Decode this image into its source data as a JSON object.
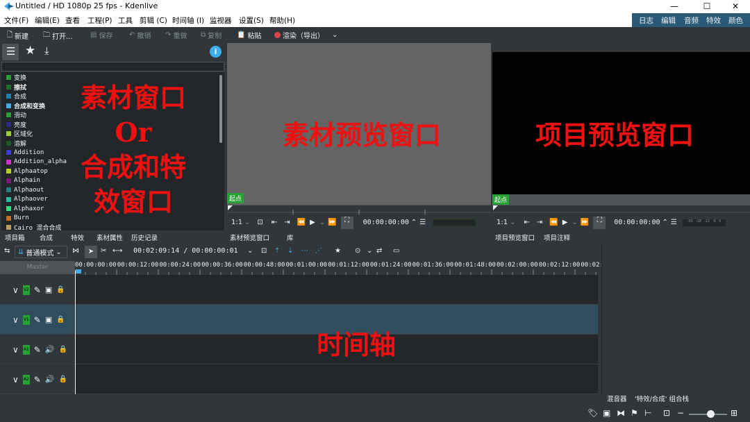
{
  "window": {
    "title": "Untitled / HD 1080p 25 fps - Kdenlive",
    "min": "—",
    "max": "☐",
    "close": "✕"
  },
  "menu": [
    "文件(F)",
    "编辑(E)",
    "查看",
    "工程(P)",
    "工具",
    "剪辑 (C)",
    "时间轴 (I)",
    "监视器",
    "设置(S)",
    "帮助(H)"
  ],
  "layouts": [
    "日志",
    "编辑",
    "音频",
    "特效",
    "颜色"
  ],
  "toolbar": {
    "new": "新建",
    "open": "打开...",
    "save": "保存",
    "undo": "撤销",
    "redo": "重做",
    "copy": "复制",
    "paste": "粘贴",
    "render": "渲染（导出）"
  },
  "effects": [
    {
      "label": "变换",
      "color": "#27a036",
      "bold": false
    },
    {
      "label": "擦拭",
      "color": "#1f6f2a",
      "bold": true
    },
    {
      "label": "合成",
      "color": "#1d7fb8",
      "bold": false
    },
    {
      "label": "合成和变换",
      "color": "#3daee9",
      "bold": true
    },
    {
      "label": "滑动",
      "color": "#27a036",
      "bold": false
    },
    {
      "label": "亮度",
      "color": "#2a2a8a",
      "bold": false
    },
    {
      "label": "区域化",
      "color": "#9acd32",
      "bold": false
    },
    {
      "label": "溶解",
      "color": "#1a5a2a",
      "bold": false
    },
    {
      "label": "Addition",
      "color": "#3a3ae0",
      "bold": false
    },
    {
      "label": "Addition_alpha",
      "color": "#d030d0",
      "bold": false
    },
    {
      "label": "Alphaatop",
      "color": "#b8d020",
      "bold": false
    },
    {
      "label": "Alphain",
      "color": "#7a1a7a",
      "bold": false
    },
    {
      "label": "Alphaout",
      "color": "#208080",
      "bold": false
    },
    {
      "label": "Alphaover",
      "color": "#20c0a0",
      "bold": false
    },
    {
      "label": "Alphaxor",
      "color": "#30e080",
      "bold": false
    },
    {
      "label": "Burn",
      "color": "#c07020",
      "bold": false
    },
    {
      "label": "Cairo 混合合成",
      "color": "#c0a060",
      "bold": false
    }
  ],
  "annotations": {
    "left": [
      "素材窗口",
      "Or",
      "合成和特",
      "效窗口"
    ],
    "clip": "素材预览窗口",
    "project": "项目预览窗口",
    "timeline": "时间轴"
  },
  "leftTabs": [
    "项目箱",
    "合成",
    "特效",
    "素材属性",
    "历史记录"
  ],
  "monitor": {
    "start": "起点",
    "zoom": "1:1",
    "timecode": "00:00:00:00",
    "clipTabs": [
      "素材预览窗口",
      "库"
    ],
    "projTabs": [
      "项目预览窗口",
      "项目注释"
    ],
    "meter": [
      "-30",
      "-18",
      "-12",
      "-6",
      "0"
    ]
  },
  "timelineToolbar": {
    "mode": "普通模式",
    "position": "00:02:09:14 / 00:00:00:01"
  },
  "ruler": [
    "00:00:00:00",
    "00:00:12:00",
    "00:00:24:00",
    "00:00:36:00",
    "00:00:48:00",
    "00:01:00:00",
    "00:01:12:00",
    "00:01:24:00",
    "00:01:36:00",
    "00:01:48:00",
    "00:02:00:00",
    "00:02:12:00",
    "00:02:"
  ],
  "tracks": {
    "master": "Master",
    "items": [
      {
        "label": "V2",
        "kind": "video"
      },
      {
        "label": "V1",
        "kind": "video"
      },
      {
        "label": "A1",
        "kind": "audio"
      },
      {
        "label": "A2",
        "kind": "audio"
      }
    ]
  },
  "rightTabs": [
    "混音器",
    "'特效/合成' 组合栈"
  ],
  "colors": {
    "selectedTrack": "#2f4d5c",
    "accent": "#3daee9",
    "track": "#27a036",
    "annotation": "#e11111"
  }
}
